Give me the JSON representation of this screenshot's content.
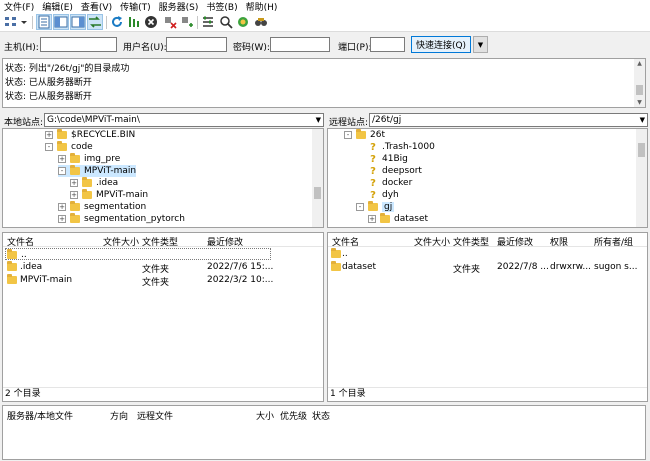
{
  "menu": [
    "文件(F)",
    "编辑(E)",
    "查看(V)",
    "传输(T)",
    "服务器(S)",
    "书签(B)",
    "帮助(H)"
  ],
  "toolbar": {
    "icons": [
      "site-manager-icon",
      "dropdown-icon",
      "toggle-log-icon",
      "toggle-local-tree-icon",
      "toggle-remote-tree-icon",
      "toggle-queue-icon",
      "refresh-icon",
      "process-queue-icon",
      "cancel-icon",
      "disconnect-icon",
      "reconnect-icon",
      "filter-icon",
      "compare-icon",
      "sync-browse-icon",
      "search-icon"
    ]
  },
  "quickconnect": {
    "host_label": "主机(H):",
    "user_label": "用户名(U):",
    "pass_label": "密码(W):",
    "port_label": "端口(P):",
    "button": "快速连接(Q)",
    "host_value": "",
    "user_value": "",
    "pass_value": "",
    "port_value": ""
  },
  "log": [
    "状态: 列出\"/26t/gj\"的目录成功",
    "状态: 已从服务器断开",
    "状态: 已从服务器断开"
  ],
  "local": {
    "site_label": "本地站点:",
    "path": "G:\\code\\MPViT-main\\",
    "tree": [
      {
        "label": "$RECYCLE.BIN",
        "depth": 1,
        "expander": "+"
      },
      {
        "label": "code",
        "depth": 1,
        "expander": "-"
      },
      {
        "label": "img_pre",
        "depth": 2,
        "expander": "+"
      },
      {
        "label": "MPViT-main",
        "depth": 2,
        "expander": "-"
      },
      {
        "label": ".idea",
        "depth": 3,
        "expander": "+"
      },
      {
        "label": "MPViT-main",
        "depth": 3,
        "expander": "+"
      },
      {
        "label": "segmentation",
        "depth": 2,
        "expander": "+"
      },
      {
        "label": "segmentation_pytorch",
        "depth": 2,
        "expander": "+"
      }
    ],
    "columns": [
      "文件名",
      "文件大小",
      "文件类型",
      "最近修改"
    ],
    "rows": [
      {
        "name": "..",
        "size": "",
        "type": "",
        "modified": ""
      },
      {
        "name": ".idea",
        "size": "",
        "type": "文件夹",
        "modified": "2022/7/6 15:..."
      },
      {
        "name": "MPViT-main",
        "size": "",
        "type": "文件夹",
        "modified": "2022/3/2 10:..."
      }
    ],
    "status": "2 个目录"
  },
  "remote": {
    "site_label": "远程站点:",
    "path": "/26t/gj",
    "tree": [
      {
        "label": "26t",
        "depth": 1,
        "icon": "folder",
        "expander": "-"
      },
      {
        "label": ".Trash-1000",
        "depth": 2,
        "icon": "question"
      },
      {
        "label": "41Big",
        "depth": 2,
        "icon": "question"
      },
      {
        "label": "deepsort",
        "depth": 2,
        "icon": "question"
      },
      {
        "label": "docker",
        "depth": 2,
        "icon": "question"
      },
      {
        "label": "dyh",
        "depth": 2,
        "icon": "question"
      },
      {
        "label": "gj",
        "depth": 2,
        "icon": "folder",
        "expander": "-"
      },
      {
        "label": "dataset",
        "depth": 3,
        "icon": "folder",
        "expander": "+"
      }
    ],
    "columns": [
      "文件名",
      "文件大小",
      "文件类型",
      "最近修改",
      "权限",
      "所有者/组"
    ],
    "rows": [
      {
        "name": "..",
        "size": "",
        "type": "",
        "modified": "",
        "perms": "",
        "owner": ""
      },
      {
        "name": "dataset",
        "size": "",
        "type": "文件夹",
        "modified": "2022/7/8 ...",
        "perms": "drwxrw...",
        "owner": "sugon s..."
      }
    ],
    "status": "1 个目录"
  },
  "queue": {
    "columns": [
      "服务器/本地文件",
      "方向",
      "远程文件",
      "大小",
      "优先级",
      "状态"
    ]
  }
}
